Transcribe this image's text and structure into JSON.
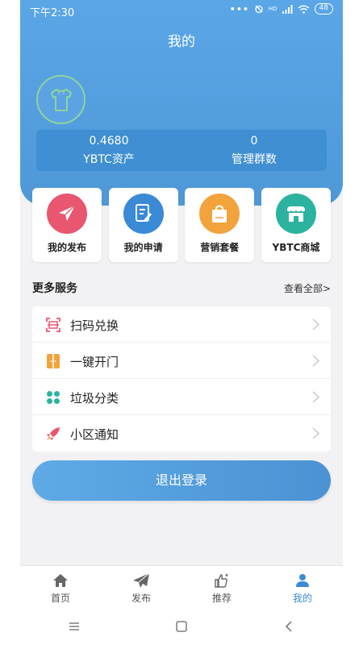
{
  "status_bar": {
    "time": "下午2:30",
    "dots": "•••",
    "network": "HD",
    "battery": "48"
  },
  "header": {
    "title": "我的"
  },
  "profile": {
    "stats": [
      {
        "value": "0.4680",
        "label": "YBTC资产"
      },
      {
        "value": "0",
        "label": "管理群数"
      }
    ]
  },
  "shortcuts": [
    {
      "label": "我的发布",
      "color": "#e8566f",
      "icon": "send-icon"
    },
    {
      "label": "我的申请",
      "color": "#3a8ad6",
      "icon": "edit-document-icon"
    },
    {
      "label": "营销套餐",
      "color": "#f2a33c",
      "icon": "shopping-bag-icon"
    },
    {
      "label": "YBTC商城",
      "color": "#2bb3a0",
      "icon": "shop-icon"
    }
  ],
  "services": {
    "title": "更多服务",
    "view_all": "查看全部>",
    "items": [
      {
        "label": "扫码兑换",
        "icon": "scan-icon"
      },
      {
        "label": "一键开门",
        "icon": "door-icon"
      },
      {
        "label": "垃圾分类",
        "icon": "clover-icon"
      },
      {
        "label": "小区通知",
        "icon": "rocket-icon"
      }
    ]
  },
  "logout_label": "退出登录",
  "tabbar": {
    "tabs": [
      {
        "label": "首页",
        "icon": "home-icon",
        "active": false
      },
      {
        "label": "发布",
        "icon": "paper-plane-icon",
        "active": false
      },
      {
        "label": "推荐",
        "icon": "thumbs-up-icon",
        "active": false
      },
      {
        "label": "我的",
        "icon": "user-icon",
        "active": true
      }
    ]
  },
  "colors": {
    "primary": "#4f98d8",
    "accent_active": "#3a8ad6",
    "avatar_ring": "#8ed39e"
  }
}
